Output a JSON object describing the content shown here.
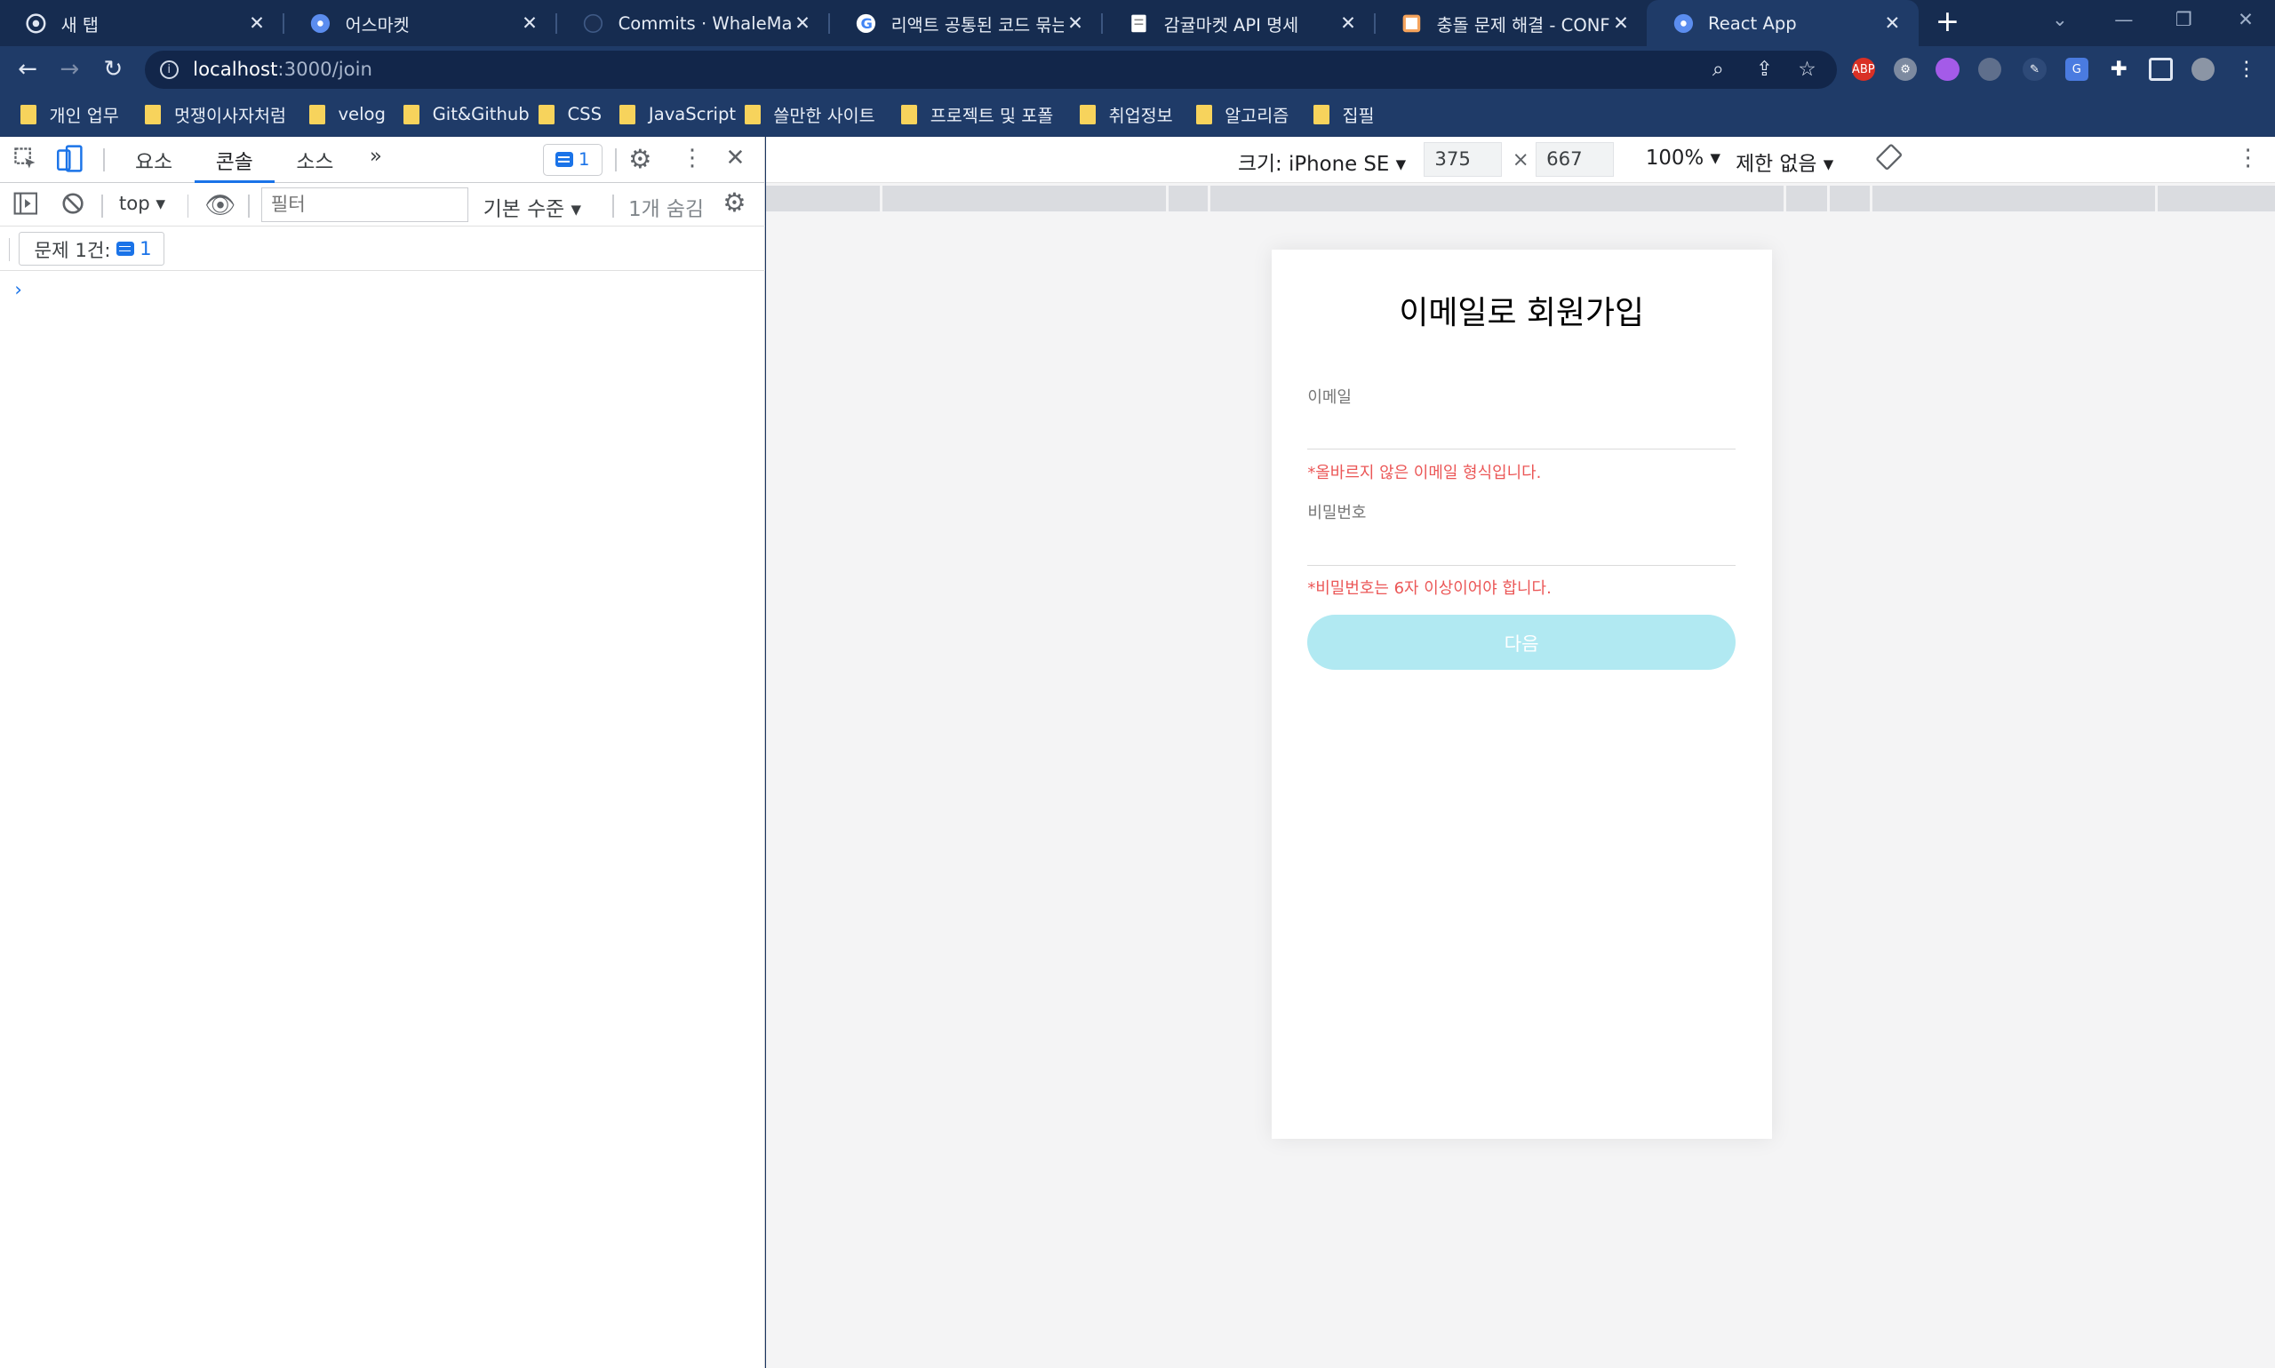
{
  "tabs": [
    {
      "title": "새 탭",
      "icon": "chrome-icon"
    },
    {
      "title": "어스마켓",
      "icon": "react-icon"
    },
    {
      "title": "Commits · WhaleMarket/W",
      "icon": "github-icon"
    },
    {
      "title": "리액트 공통된 코드 묶는",
      "icon": "google-icon"
    },
    {
      "title": "감귤마켓 API 명세",
      "icon": "doc-icon"
    },
    {
      "title": "충돌 문제 해결 - CONFLIC",
      "icon": "page-icon"
    },
    {
      "title": "React App",
      "icon": "react-icon"
    }
  ],
  "address": {
    "host": "localhost",
    "path": ":3000/join"
  },
  "bookmarks": [
    "개인 업무",
    "멋쟁이사자처럼",
    "velog",
    "Git&Github",
    "CSS",
    "JavaScript",
    "쓸만한 사이트",
    "프로젝트 및 포폴",
    "취업정보",
    "알고리즘",
    "집필"
  ],
  "devtools": {
    "tabs": [
      "요소",
      "콘솔",
      "소스"
    ],
    "more": "»",
    "badge_count": "1",
    "context": "top",
    "filter_placeholder": "필터",
    "level": "기본 수준",
    "hidden": "1개 숨김",
    "issues_label": "문제 1건:",
    "issues_count": "1",
    "prompt": "›"
  },
  "emulation": {
    "size_label": "크기: iPhone SE",
    "width": "375",
    "times": "×",
    "height": "667",
    "zoom": "100%",
    "throttle": "제한 없음"
  },
  "page": {
    "title": "이메일로 회원가입",
    "email_label": "이메일",
    "email_error": "*올바르지 않은 이메일 형식입니다.",
    "password_label": "비밀번호",
    "password_error": "*비밀번호는 6자 이상이어야 합니다.",
    "next_button": "다음"
  },
  "colors": {
    "tabstrip": "#162c50",
    "toolbar": "#1f3b68",
    "accent": "#1a73e8",
    "error": "#eb5757",
    "button_disabled": "#b1e9f2"
  }
}
